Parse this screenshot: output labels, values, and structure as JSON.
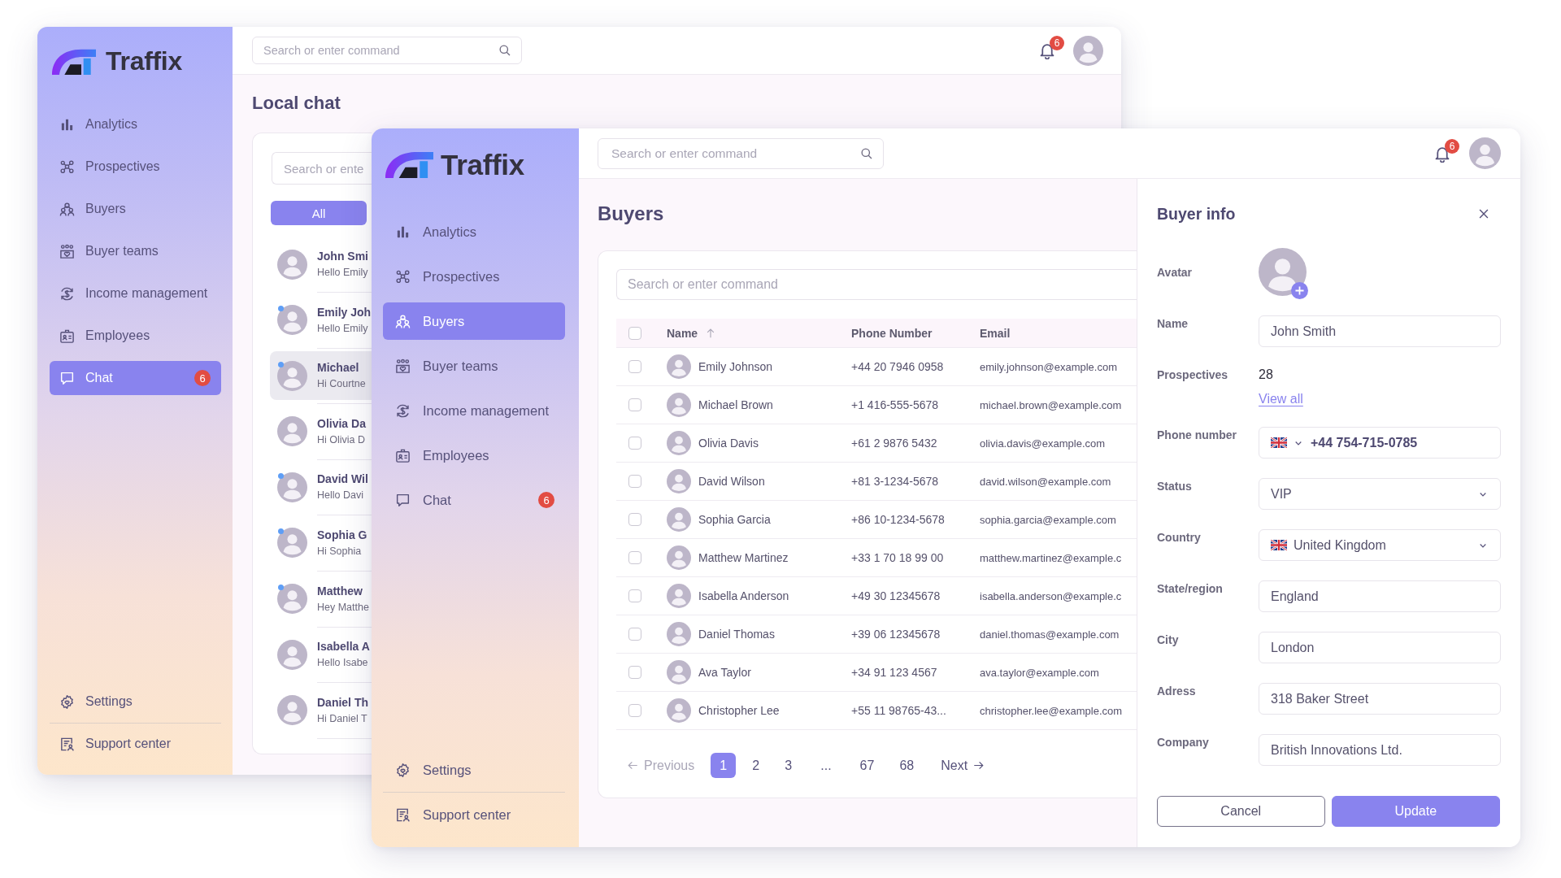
{
  "back_window": {
    "sidebar": {
      "logo": "Traffix",
      "items": [
        {
          "label": "Analytics",
          "selected": false
        },
        {
          "label": "Prospectives",
          "selected": false
        },
        {
          "label": "Buyers",
          "selected": false
        },
        {
          "label": "Buyer teams",
          "selected": false
        },
        {
          "label": "Income management",
          "selected": false
        },
        {
          "label": "Employees",
          "selected": false
        },
        {
          "label": "Chat",
          "selected": true,
          "badge": "6"
        }
      ],
      "footer_items": [
        {
          "label": "Settings"
        },
        {
          "label": "Support center"
        }
      ]
    },
    "header": {
      "search": {
        "placeholder": "Search or enter command"
      },
      "notification_count": "6"
    },
    "page_title": "Local chat",
    "chat_list": {
      "search": {
        "placeholder": "Search or ente"
      },
      "filters": [
        {
          "label": "All",
          "selected": true
        }
      ],
      "conversations": [
        {
          "name": "John Smi",
          "preview": "Hello Emily",
          "unread": false,
          "selected": false
        },
        {
          "name": "Emily Joh",
          "preview": "Hello Emily",
          "unread": true,
          "selected": false
        },
        {
          "name": "Michael",
          "preview": "Hi Courtne",
          "unread": true,
          "selected": true
        },
        {
          "name": "Olivia Da",
          "preview": "Hi Olivia D",
          "unread": false,
          "selected": false
        },
        {
          "name": "David Wil",
          "preview": "Hello Davi",
          "unread": true,
          "selected": false
        },
        {
          "name": "Sophia G",
          "preview": "Hi Sophia",
          "unread": true,
          "selected": false
        },
        {
          "name": "Matthew",
          "preview": "Hey Matthe",
          "unread": true,
          "selected": false
        },
        {
          "name": "Isabella A",
          "preview": "Hello Isabe",
          "unread": false,
          "selected": false
        },
        {
          "name": "Daniel Th",
          "preview": "Hi Daniel T",
          "unread": false,
          "selected": false
        }
      ]
    }
  },
  "front_window": {
    "sidebar": {
      "logo": "Traffix",
      "items": [
        {
          "label": "Analytics",
          "selected": false
        },
        {
          "label": "Prospectives",
          "selected": false
        },
        {
          "label": "Buyers",
          "selected": true
        },
        {
          "label": "Buyer teams",
          "selected": false
        },
        {
          "label": "Income management",
          "selected": false
        },
        {
          "label": "Employees",
          "selected": false
        },
        {
          "label": "Chat",
          "selected": false,
          "badge": "6"
        }
      ],
      "footer_items": [
        {
          "label": "Settings"
        },
        {
          "label": "Support center"
        }
      ]
    },
    "header": {
      "search": {
        "placeholder": "Search or enter command"
      },
      "notification_count": "6"
    },
    "page_title": "Buyers",
    "buyers_card": {
      "search": {
        "placeholder": "Search or enter command"
      },
      "table": {
        "select_all": {
          "checked": false
        },
        "columns": [
          {
            "label": "Name",
            "sorted": true
          },
          {
            "label": "Phone Number",
            "sorted": false
          },
          {
            "label": "Email",
            "sorted": false
          }
        ],
        "rows": [
          {
            "name": "Emily Johnson",
            "phone": "+44 20 7946 0958",
            "email": "emily.johnson@example.com",
            "checked": false
          },
          {
            "name": "Michael Brown",
            "phone": "+1 416-555-5678",
            "email": "michael.brown@example.com",
            "checked": false
          },
          {
            "name": "Olivia Davis",
            "phone": "+61 2 9876 5432",
            "email": "olivia.davis@example.com",
            "checked": false
          },
          {
            "name": "David Wilson",
            "phone": "+81 3-1234-5678",
            "email": "david.wilson@example.com",
            "checked": false
          },
          {
            "name": "Sophia Garcia",
            "phone": "+86 10-1234-5678",
            "email": "sophia.garcia@example.com",
            "checked": false
          },
          {
            "name": "Matthew Martinez",
            "phone": "+33 1 70 18 99 00",
            "email": "matthew.martinez@example.c",
            "checked": false
          },
          {
            "name": "Isabella Anderson",
            "phone": "+49 30 12345678",
            "email": "isabella.anderson@example.c",
            "checked": false
          },
          {
            "name": "Daniel Thomas",
            "phone": "+39 06 12345678",
            "email": "daniel.thomas@example.com",
            "checked": false
          },
          {
            "name": "Ava Taylor",
            "phone": "+34 91 123 4567",
            "email": "ava.taylor@example.com",
            "checked": false
          },
          {
            "name": "Christopher Lee",
            "phone": "+55 11 98765-43...",
            "email": "christopher.lee@example.com",
            "checked": false
          }
        ]
      },
      "pagination": {
        "previous": {
          "label": "Previous",
          "disabled": true
        },
        "pages": [
          {
            "label": "1",
            "kind": "page",
            "selected": true
          },
          {
            "label": "2",
            "kind": "page",
            "selected": false
          },
          {
            "label": "3",
            "kind": "page",
            "selected": false
          },
          {
            "label": "...",
            "kind": "gap",
            "selected": false
          },
          {
            "label": "67",
            "kind": "page",
            "selected": false
          },
          {
            "label": "68",
            "kind": "page",
            "selected": false
          }
        ],
        "next": {
          "label": "Next",
          "disabled": false
        }
      }
    },
    "buyer_info": {
      "title": "Buyer info",
      "fields": [
        {
          "kind": "avatar",
          "label": "Avatar"
        },
        {
          "kind": "text",
          "label": "Name",
          "value": "John Smith"
        },
        {
          "kind": "count",
          "label": "Prospectives",
          "value": "28",
          "link": "View all"
        },
        {
          "kind": "phone",
          "label": "Phone number",
          "value": "+44 754-715-0785"
        },
        {
          "kind": "select",
          "label": "Status",
          "value": "VIP"
        },
        {
          "kind": "country",
          "label": "Country",
          "value": "United Kingdom"
        },
        {
          "kind": "text",
          "label": "State/region",
          "value": "England"
        },
        {
          "kind": "text",
          "label": "City",
          "value": "London"
        },
        {
          "kind": "text",
          "label": "Adress",
          "value": "318 Baker Street"
        },
        {
          "kind": "text",
          "label": "Company",
          "value": "British Innovations Ltd."
        }
      ],
      "buttons": [
        {
          "label": "Cancel",
          "kind": "secondary"
        },
        {
          "label": "Update",
          "kind": "primary"
        }
      ]
    }
  }
}
